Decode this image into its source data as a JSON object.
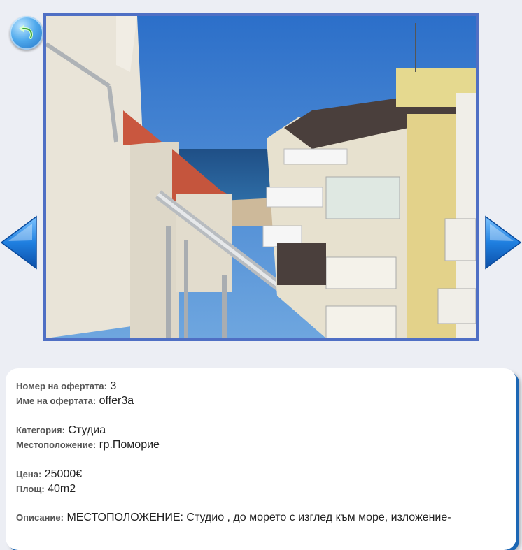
{
  "icons": {
    "back": "back-arrow-icon",
    "prev": "arrow-left-icon",
    "next": "arrow-right-icon"
  },
  "colors": {
    "page_bg": "#eceef4",
    "frame": "#4f6fc4",
    "arrow_blue": "#1a73d4",
    "card_shadow": "#1c67b4"
  },
  "offer": {
    "number_label": "Номер на офертата:",
    "number_value": "3",
    "name_label": "Име на офертата:",
    "name_value": "offer3a",
    "category_label": "Категория:",
    "category_value": "Студиа",
    "location_label": "Местоположение:",
    "location_value": "гр.Поморие",
    "price_label": "Цена:",
    "price_value": "25000€",
    "area_label": "Площ:",
    "area_value": "40m2",
    "description_label": "Описание:",
    "description_value": "МЕСТОПОЛОЖЕНИЕ: Студио , до морето с изглед към море, изложение-"
  }
}
